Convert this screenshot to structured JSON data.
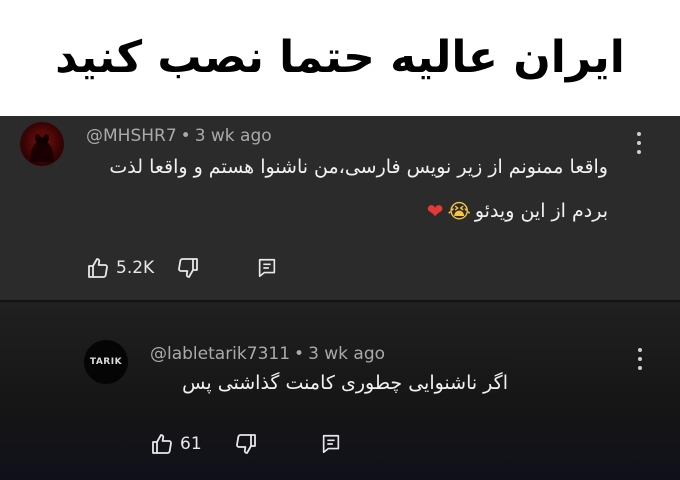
{
  "banner": {
    "title": "ایران عالیه حتما نصب کنید"
  },
  "comments": [
    {
      "username": "@MHSHR7",
      "separator": "•",
      "age": "3 wk ago",
      "text_line1": "واقعا ممنونم از زیر نویس فارسی،من ناشنوا هستم و واقعا لذت",
      "text_line2": "بردم از این ویدئو",
      "emoji1": "😭",
      "emoji2": "❤",
      "likes": "5.2K"
    },
    {
      "username": "@labletarik7311",
      "separator": "•",
      "age": "3 wk ago",
      "text": "اگر ناشنوایی چطوری کامنت گذاشتی پس",
      "avatar_text": "TARIK",
      "likes": "61"
    }
  ],
  "icons": [
    "thumbs-up-icon",
    "thumbs-down-icon",
    "reply-icon",
    "more-vert-icon"
  ]
}
